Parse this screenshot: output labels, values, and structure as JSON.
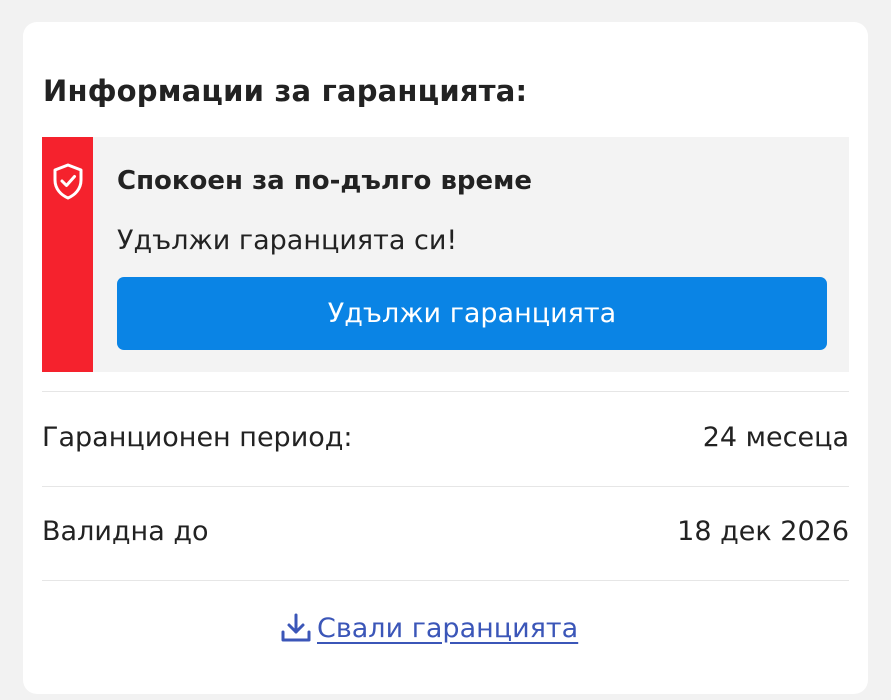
{
  "warranty": {
    "title": "Информации за гаранцията:",
    "promo": {
      "icon": "shield-check-icon",
      "accent_color": "#f5222d",
      "title": "Спокоен за по-дълго време",
      "subtitle": "Удължи гаранцията си!",
      "button_label": "Удължи гаранцията",
      "button_color": "#0a84e5"
    },
    "details": [
      {
        "label": "Гаранционен период:",
        "value": "24 месеца"
      },
      {
        "label": "Валидна до",
        "value": "18 дек 2026"
      }
    ],
    "download": {
      "icon": "download-icon",
      "label": "Свали гаранцията",
      "color": "#3b56b8"
    }
  }
}
